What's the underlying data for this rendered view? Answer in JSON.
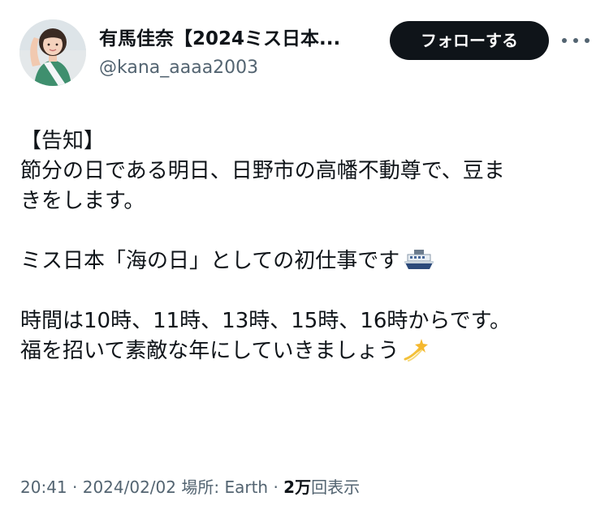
{
  "user": {
    "name": "有馬佳奈【2024ミス日本...",
    "handle": "@kana_aaaa2003",
    "follow_label": "フォローする"
  },
  "tweet": {
    "lines": [
      "【告知】",
      "節分の日である明日、日野市の高幡不動尊で、豆ま",
      "きをします。",
      "ミス日本「海の日」としての初仕事です",
      "時間は10時、11時、13時、15時、16時からです。",
      "福を招いて素敵な年にしていきましょう"
    ],
    "emoji_after_line_4": "ship-emoji",
    "emoji_after_line_6": "dizzy-emoji"
  },
  "meta": {
    "time": "20:41",
    "sep1": "·",
    "date": "2024/02/02",
    "location": "場所: Earth",
    "sep2": "·",
    "views_count": "2万",
    "views_label": "回表示"
  },
  "colors": {
    "text": "#0f1419",
    "secondary": "#536471",
    "button_bg": "#0f1419",
    "button_text": "#ffffff"
  },
  "icons": [
    "avatar",
    "more-icon",
    "ship-emoji",
    "dizzy-emoji"
  ]
}
